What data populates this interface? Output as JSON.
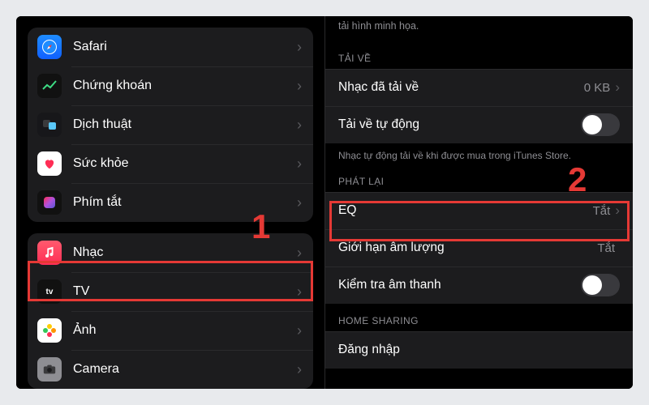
{
  "annotations": {
    "step1": "1",
    "step2": "2"
  },
  "left": {
    "items": [
      {
        "id": "safari",
        "label": "Safari"
      },
      {
        "id": "stocks",
        "label": "Chứng khoán"
      },
      {
        "id": "translate",
        "label": "Dịch thuật"
      },
      {
        "id": "health",
        "label": "Sức khỏe"
      },
      {
        "id": "shortcuts",
        "label": "Phím tắt"
      },
      {
        "id": "music",
        "label": "Nhạc"
      },
      {
        "id": "tv",
        "label": "TV"
      },
      {
        "id": "photos",
        "label": "Ảnh"
      },
      {
        "id": "camera",
        "label": "Camera"
      }
    ]
  },
  "right": {
    "top_caption": "tải hình minh họa.",
    "downloads_header": "TẢI VỀ",
    "downloaded_label": "Nhạc đã tải về",
    "downloaded_value": "0 KB",
    "auto_download_label": "Tải về tự động",
    "auto_download_on": false,
    "downloads_footnote": "Nhạc tự động tải về khi được mua trong iTunes Store.",
    "playback_header": "PHÁT LẠI",
    "eq_label": "EQ",
    "eq_value": "Tắt",
    "volume_limit_label": "Giới hạn âm lượng",
    "volume_limit_value": "Tắt",
    "sound_check_label": "Kiểm tra âm thanh",
    "sound_check_on": false,
    "home_sharing_header": "HOME SHARING",
    "signin_label": "Đăng nhập"
  }
}
